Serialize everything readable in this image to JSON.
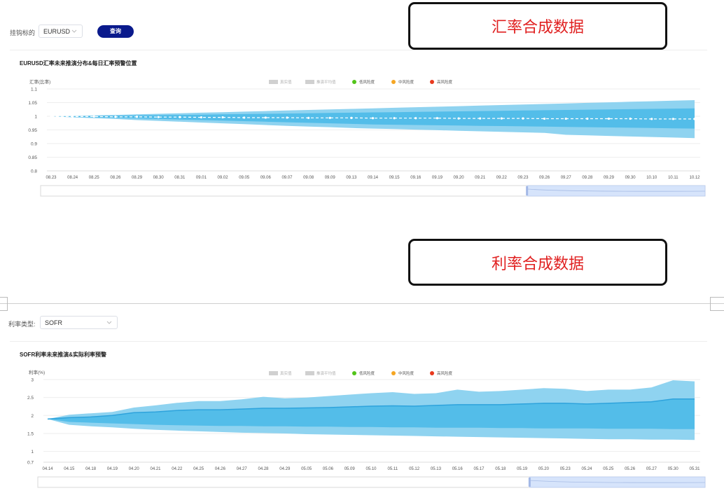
{
  "fx": {
    "filter_label": "挂钩标的",
    "select_value": "EURUSD",
    "query_button": "查询",
    "callout": "汇率合成数据",
    "card_title": "EURUSD汇率未来推演分布&每日汇率预警位置",
    "legend": [
      "真实值",
      "推演平均值",
      "低风险度",
      "中风险度",
      "高风险度"
    ]
  },
  "rate": {
    "filter_label": "利率类型:",
    "select_value": "SOFR",
    "callout": "利率合成数据",
    "card_title": "SOFR利率未来推演&实际利率预警",
    "legend": [
      "真实值",
      "推演平均值",
      "低风险度",
      "中风险度",
      "高风险度"
    ]
  },
  "colors": {
    "button": "#0a1a8c",
    "callout_text": "#e02020",
    "band_outer": "#8fd3f0",
    "band_inner": "#53bde9",
    "mean_line": "#2ea3dc",
    "legend_grey": "#d0d0d0",
    "low": "#52c41a",
    "mid": "#f5a623",
    "high": "#e8391d"
  },
  "chart_data": [
    {
      "type": "area",
      "ylabel": "汇率(比率)",
      "ylim": [
        0.8,
        1.1
      ],
      "yticks": [
        "1.1",
        "1.05",
        "1",
        "0.95",
        "0.9",
        "0.85",
        "0.8"
      ],
      "categories": [
        "08.23",
        "08.24",
        "08.25",
        "08.26",
        "08.29",
        "08.30",
        "08.31",
        "09.01",
        "09.02",
        "09.05",
        "09.06",
        "09.07",
        "09.08",
        "09.09",
        "09.13",
        "09.14",
        "09.15",
        "09.16",
        "09.19",
        "09.20",
        "09.21",
        "09.22",
        "09.23",
        "09.26",
        "09.27",
        "09.28",
        "09.29",
        "09.30",
        "10.10",
        "10.11",
        "10.12"
      ],
      "outer_upper": [
        1.0,
        1.001,
        1.003,
        1.005,
        1.007,
        1.009,
        1.011,
        1.013,
        1.015,
        1.017,
        1.019,
        1.021,
        1.023,
        1.025,
        1.027,
        1.029,
        1.031,
        1.033,
        1.035,
        1.037,
        1.039,
        1.041,
        1.043,
        1.045,
        1.047,
        1.049,
        1.051,
        1.053,
        1.055,
        1.057,
        1.059
      ],
      "inner_upper": [
        1.0,
        1.0,
        1.001,
        1.002,
        1.003,
        1.004,
        1.005,
        1.006,
        1.007,
        1.008,
        1.009,
        1.01,
        1.011,
        1.012,
        1.013,
        1.014,
        1.015,
        1.016,
        1.017,
        1.018,
        1.019,
        1.02,
        1.021,
        1.022,
        1.023,
        1.024,
        1.025,
        1.026,
        1.027,
        1.028,
        1.029
      ],
      "mean": [
        1.0,
        0.999,
        0.999,
        0.998,
        0.998,
        0.997,
        0.997,
        0.996,
        0.996,
        0.995,
        0.995,
        0.995,
        0.994,
        0.994,
        0.994,
        0.993,
        0.993,
        0.993,
        0.993,
        0.992,
        0.992,
        0.992,
        0.992,
        0.991,
        0.991,
        0.991,
        0.991,
        0.991,
        0.99,
        0.99,
        0.99
      ],
      "inner_lower": [
        1.0,
        0.998,
        0.996,
        0.994,
        0.992,
        0.99,
        0.988,
        0.986,
        0.984,
        0.982,
        0.98,
        0.978,
        0.976,
        0.974,
        0.972,
        0.97,
        0.969,
        0.968,
        0.967,
        0.966,
        0.965,
        0.964,
        0.963,
        0.962,
        0.961,
        0.96,
        0.959,
        0.958,
        0.957,
        0.956,
        0.955
      ],
      "outer_lower": [
        1.0,
        0.996,
        0.993,
        0.99,
        0.986,
        0.983,
        0.98,
        0.977,
        0.974,
        0.971,
        0.968,
        0.965,
        0.962,
        0.96,
        0.957,
        0.955,
        0.953,
        0.951,
        0.949,
        0.947,
        0.945,
        0.943,
        0.941,
        0.939,
        0.932,
        0.93,
        0.928,
        0.926,
        0.924,
        0.922,
        0.92
      ]
    },
    {
      "type": "area",
      "ylabel": "利率(%)",
      "ylim": [
        0.7,
        3
      ],
      "yticks": [
        "3",
        "2.5",
        "2",
        "1.5",
        "1",
        "0.7"
      ],
      "categories": [
        "04.14",
        "04.15",
        "04.18",
        "04.19",
        "04.20",
        "04.21",
        "04.22",
        "04.25",
        "04.26",
        "04.27",
        "04.28",
        "04.29",
        "05.05",
        "05.06",
        "05.09",
        "05.10",
        "05.11",
        "05.12",
        "05.13",
        "05.16",
        "05.17",
        "05.18",
        "05.19",
        "05.20",
        "05.23",
        "05.24",
        "05.25",
        "05.26",
        "05.27",
        "05.30",
        "05.31"
      ],
      "outer_upper": [
        1.9,
        2.02,
        2.06,
        2.1,
        2.22,
        2.28,
        2.35,
        2.4,
        2.4,
        2.45,
        2.52,
        2.48,
        2.5,
        2.54,
        2.58,
        2.62,
        2.65,
        2.6,
        2.62,
        2.72,
        2.66,
        2.68,
        2.72,
        2.76,
        2.74,
        2.68,
        2.72,
        2.72,
        2.78,
        2.98,
        2.95
      ],
      "inner_upper": [
        1.9,
        1.94,
        1.96,
        2.0,
        2.08,
        2.1,
        2.14,
        2.16,
        2.16,
        2.18,
        2.2,
        2.2,
        2.21,
        2.22,
        2.24,
        2.26,
        2.27,
        2.26,
        2.28,
        2.3,
        2.3,
        2.3,
        2.32,
        2.34,
        2.34,
        2.32,
        2.34,
        2.36,
        2.38,
        2.46,
        2.46
      ],
      "mean": [
        1.9,
        1.94,
        1.96,
        2.0,
        2.08,
        2.1,
        2.14,
        2.16,
        2.16,
        2.18,
        2.2,
        2.2,
        2.21,
        2.22,
        2.24,
        2.26,
        2.27,
        2.26,
        2.28,
        2.3,
        2.3,
        2.3,
        2.32,
        2.34,
        2.34,
        2.32,
        2.34,
        2.36,
        2.38,
        2.46,
        2.46
      ],
      "inner_lower": [
        1.9,
        1.82,
        1.8,
        1.78,
        1.76,
        1.74,
        1.73,
        1.72,
        1.71,
        1.71,
        1.7,
        1.7,
        1.69,
        1.69,
        1.68,
        1.68,
        1.67,
        1.67,
        1.66,
        1.66,
        1.66,
        1.65,
        1.65,
        1.64,
        1.64,
        1.64,
        1.63,
        1.63,
        1.63,
        1.62,
        1.62
      ],
      "outer_lower": [
        1.9,
        1.74,
        1.7,
        1.67,
        1.63,
        1.6,
        1.58,
        1.56,
        1.54,
        1.52,
        1.51,
        1.5,
        1.48,
        1.47,
        1.46,
        1.45,
        1.44,
        1.43,
        1.42,
        1.41,
        1.4,
        1.39,
        1.38,
        1.37,
        1.36,
        1.35,
        1.34,
        1.34,
        1.33,
        1.33,
        1.32
      ]
    }
  ]
}
